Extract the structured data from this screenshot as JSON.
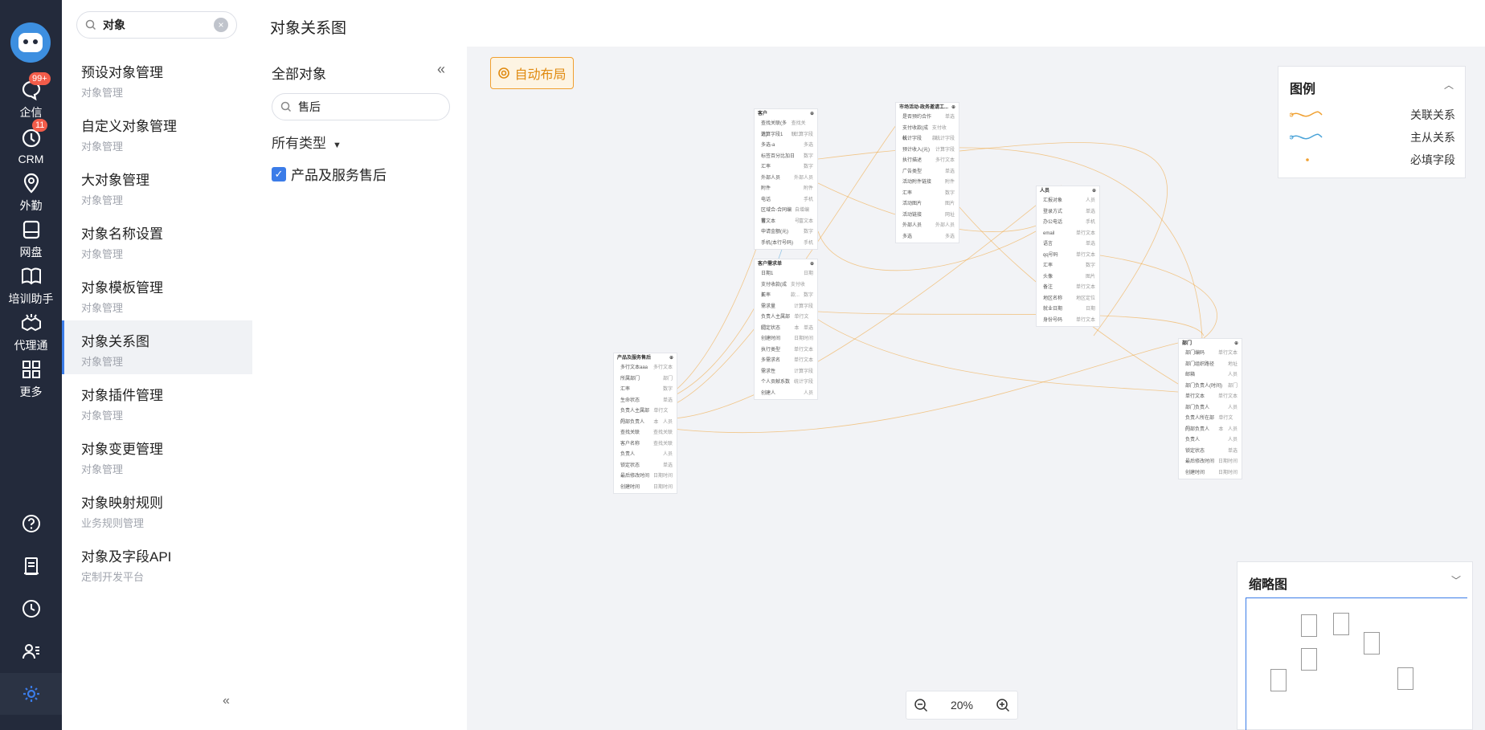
{
  "rail": {
    "items": [
      {
        "label": "企信",
        "icon": "chat-icon",
        "badge": "99+"
      },
      {
        "label": "CRM",
        "icon": "crm-icon",
        "badge": "11"
      },
      {
        "label": "外勤",
        "icon": "location-icon"
      },
      {
        "label": "网盘",
        "icon": "disk-icon"
      },
      {
        "label": "培训助手",
        "icon": "book-icon"
      },
      {
        "label": "代理通",
        "icon": "handshake-icon"
      },
      {
        "label": "更多",
        "icon": "grid-icon"
      }
    ],
    "bottom_icons": [
      "help-icon",
      "notes-icon",
      "clock-icon",
      "contacts-icon",
      "settings-icon"
    ]
  },
  "menu": {
    "search_value": "对象",
    "items": [
      {
        "title": "预设对象管理",
        "sub": "对象管理"
      },
      {
        "title": "自定义对象管理",
        "sub": "对象管理"
      },
      {
        "title": "大对象管理",
        "sub": "对象管理"
      },
      {
        "title": "对象名称设置",
        "sub": "对象管理"
      },
      {
        "title": "对象模板管理",
        "sub": "对象管理"
      },
      {
        "title": "对象关系图",
        "sub": "对象管理"
      },
      {
        "title": "对象插件管理",
        "sub": "对象管理"
      },
      {
        "title": "对象变更管理",
        "sub": "对象管理"
      },
      {
        "title": "对象映射规则",
        "sub": "业务规则管理"
      },
      {
        "title": "对象及字段API",
        "sub": "定制开发平台"
      }
    ],
    "active_index": 5,
    "collapse_glyph": "«"
  },
  "header": {
    "title": "对象关系图"
  },
  "panel": {
    "head": "全部对象",
    "collapse_glyph": "«",
    "search_value": "售后",
    "type_select": "所有类型",
    "checkbox_label": "产品及服务售后",
    "checkbox_checked": true
  },
  "canvas": {
    "auto_layout": "自动布局",
    "zoom_level": "20%",
    "accent": "#f0a030",
    "link_orange": "#f0a030",
    "link_blue": "#4aa3d8"
  },
  "legend": {
    "title": "图例",
    "rows": [
      {
        "label": "关联关系",
        "kind": "orange-line"
      },
      {
        "label": "主从关系",
        "kind": "blue-line"
      },
      {
        "label": "必填字段",
        "kind": "dot"
      }
    ]
  },
  "minimap": {
    "title": "缩略图"
  },
  "nodes": [
    {
      "title": "客户",
      "rows": [
        [
          "查找关联(多选)",
          "查找关联..."
        ],
        [
          "计算字段1",
          "计算字段"
        ],
        [
          "多选-a",
          "多选"
        ],
        [
          "标签百分比加日",
          "数字"
        ],
        [
          "汇率",
          "数字"
        ],
        [
          "外部人员",
          "外部人员"
        ],
        [
          "附件",
          "附件"
        ],
        [
          "电话",
          "手机"
        ],
        [
          "区域合-合同编号",
          "自增编号"
        ],
        [
          "富文本",
          "富文本"
        ],
        [
          "申请金额(元)",
          "数字"
        ],
        [
          "手机(本行号码)",
          "手机"
        ]
      ]
    },
    {
      "title": "市场活动-政务邀请工...",
      "rows": [
        [
          "是否预约合作",
          "单选"
        ],
        [
          "支付收款(成长",
          "支付收款..."
        ],
        [
          "统计字段",
          "统计字段"
        ],
        [
          "预计收入(元)",
          "计算字段"
        ],
        [
          "执行描述",
          "多行文本"
        ],
        [
          "广告类型",
          "单选"
        ],
        [
          "活动附件链接",
          "附件"
        ],
        [
          "汇率",
          "数字"
        ],
        [
          "活动图片",
          "图片"
        ],
        [
          "活动链接",
          "网址"
        ],
        [
          "外部人员",
          "外部人员"
        ],
        [
          "多选",
          "多选"
        ]
      ]
    },
    {
      "title": "人员",
      "rows": [
        [
          "汇报对象",
          "人员"
        ],
        [
          "登录方式",
          "单选"
        ],
        [
          "办公电话",
          "手机"
        ],
        [
          "email",
          "单行文本"
        ],
        [
          "语言",
          "单选"
        ],
        [
          "qq号码",
          "单行文本"
        ],
        [
          "汇率",
          "数字"
        ],
        [
          "头像",
          "图片"
        ],
        [
          "备注",
          "单行文本"
        ],
        [
          "地区名称",
          "地区定位"
        ],
        [
          "就业日期",
          "日期"
        ],
        [
          "身份号码",
          "单行文本"
        ]
      ]
    },
    {
      "title": "客户需求单",
      "rows": [
        [
          "日期1",
          "日期"
        ],
        [
          "支付收款(成长",
          "支付收款..."
        ],
        [
          "汇率",
          "数字"
        ],
        [
          "需求量",
          "计算字段"
        ],
        [
          "负责人主属部门",
          "单行文本"
        ],
        [
          "锁定状态",
          "单选"
        ],
        [
          "创建时间",
          "日期时间"
        ],
        [
          "执行类型",
          "单行文本"
        ],
        [
          "多需求名",
          "单行文本"
        ],
        [
          "需求性",
          "计算字段"
        ],
        [
          "个人贡献系数",
          "统计字段"
        ],
        [
          "创建人",
          "人员"
        ]
      ]
    },
    {
      "title": "产品及服务售后",
      "rows": [
        [
          "多行文本aaa",
          "多行文本"
        ],
        [
          "所属部门",
          "部门"
        ],
        [
          "汇率",
          "数字"
        ],
        [
          "生命状态",
          "单选"
        ],
        [
          "负责人主属部门",
          "单行文本"
        ],
        [
          "外部负责人",
          "人员"
        ],
        [
          "查找关联",
          "查找关联"
        ],
        [
          "客户名称",
          "查找关联"
        ],
        [
          "负责人",
          "人员"
        ],
        [
          "锁定状态",
          "单选"
        ],
        [
          "最后修改时间",
          "日期时间"
        ],
        [
          "创建时间",
          "日期时间"
        ]
      ]
    },
    {
      "title": "部门",
      "rows": [
        [
          "部门编码",
          "单行文本"
        ],
        [
          "部门组织路径",
          "地址"
        ],
        [
          "邮箱",
          "人员"
        ],
        [
          "部门负责人(时间)",
          "部门"
        ],
        [
          "单行文本",
          "单行文本"
        ],
        [
          "部门负责人",
          "人员"
        ],
        [
          "负责人所在部门",
          "单行文本"
        ],
        [
          "外部负责人",
          "人员"
        ],
        [
          "负责人",
          "人员"
        ],
        [
          "锁定状态",
          "单选"
        ],
        [
          "最后修改时间",
          "日期时间"
        ],
        [
          "创建时间",
          "日期时间"
        ]
      ]
    }
  ]
}
